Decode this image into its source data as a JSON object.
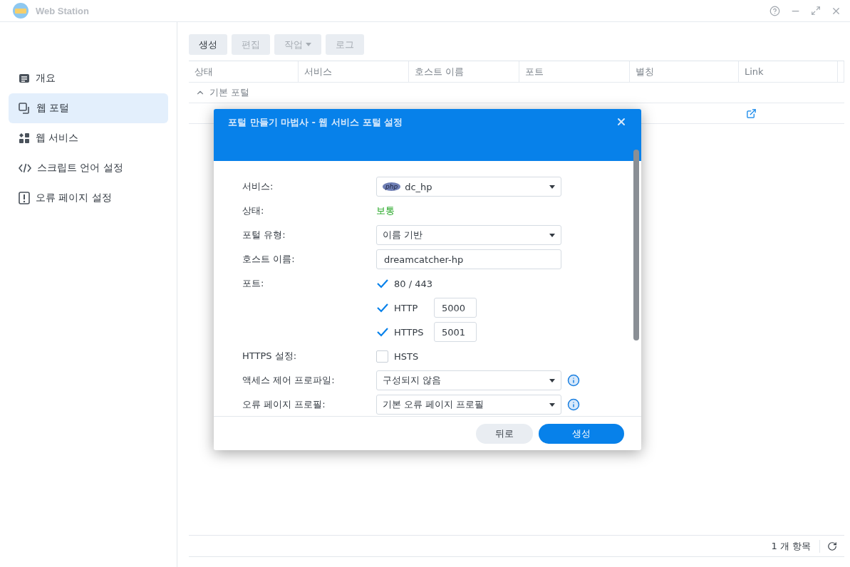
{
  "window": {
    "title": "Web Station"
  },
  "sidebar": {
    "items": [
      {
        "label": "개요",
        "selected": false,
        "kind": "overview"
      },
      {
        "label": "웹 포털",
        "selected": true,
        "kind": "portal"
      },
      {
        "label": "웹 서비스",
        "selected": false,
        "kind": "service"
      },
      {
        "label": "스크립트 언어 설정",
        "selected": false,
        "kind": "script"
      },
      {
        "label": "오류 페이지 설정",
        "selected": false,
        "kind": "error"
      }
    ]
  },
  "toolbar": {
    "buttons": [
      {
        "label": "생성",
        "disabled": false,
        "kind": "button"
      },
      {
        "label": "편집",
        "disabled": true,
        "kind": "button"
      },
      {
        "label": "작업",
        "disabled": true,
        "kind": "menu"
      },
      {
        "label": "로그",
        "disabled": true,
        "kind": "button"
      }
    ]
  },
  "table": {
    "columns": [
      "상태",
      "서비스",
      "호스트 이름",
      "포트",
      "별칭",
      "Link"
    ],
    "groups": [
      {
        "label": "기본 포털",
        "expanded": true
      }
    ]
  },
  "status_bar": {
    "count": "1 개 항목"
  },
  "dialog": {
    "title": "포털 만들기 마법사 - 웹 서비스 포털 설정",
    "fields": [
      {
        "kind": "select",
        "label": "서비스:",
        "value": "dc_hp",
        "badge": "php",
        "info": false
      },
      {
        "kind": "status",
        "label": "상태:",
        "value": "보통"
      },
      {
        "kind": "select",
        "label": "포털 유형:",
        "value": "이름 기반",
        "info": false
      },
      {
        "kind": "input",
        "label": "호스트 이름:",
        "value": "dreamcatcher-hp"
      },
      {
        "kind": "checks",
        "label": "포트:",
        "options": [
          {
            "label": "80 / 443",
            "checked": true
          },
          {
            "label": "HTTP",
            "checked": true,
            "value": "5000"
          },
          {
            "label": "HTTPS",
            "checked": true,
            "value": "5001"
          }
        ]
      },
      {
        "kind": "checks",
        "label": "HTTPS 설정:",
        "options": [
          {
            "label": "HSTS",
            "checked": false
          }
        ]
      },
      {
        "kind": "select",
        "label": "액세스 제어 프로파일:",
        "value": "구성되지 않음",
        "info": true
      },
      {
        "kind": "select",
        "label": "오류 페이지 프로필:",
        "value": "기본 오류 페이지 프로필",
        "info": true
      }
    ],
    "buttons": [
      {
        "label": "뒤로",
        "primary": false
      },
      {
        "label": "생성",
        "primary": true
      }
    ]
  }
}
